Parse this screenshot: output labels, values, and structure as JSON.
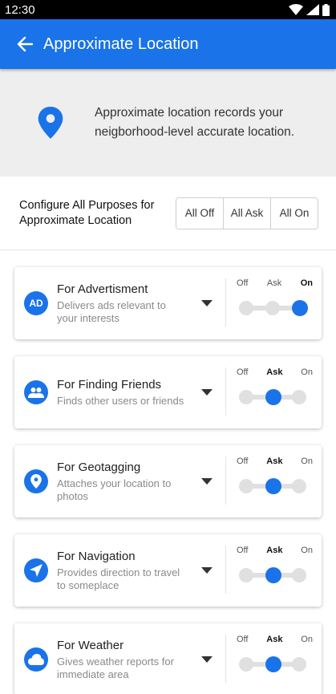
{
  "status_bar": {
    "time": "12:30"
  },
  "app_bar": {
    "title": "Approximate Location"
  },
  "info": {
    "text": "Approximate location records your neigborhood-level accurate location."
  },
  "configure": {
    "label": "Configure All Purposes for Approximate Location",
    "buttons": [
      "All Off",
      "All Ask",
      "All On"
    ]
  },
  "toggle_labels": [
    "Off",
    "Ask",
    "On"
  ],
  "purposes": [
    {
      "title": "For Advertisment",
      "desc": "Delivers ads relevant to your interests",
      "icon": "ad-icon",
      "icon_text": "AD",
      "selected": "On"
    },
    {
      "title": "For Finding Friends",
      "desc": "Finds other users or friends",
      "icon": "people-icon",
      "selected": "Ask"
    },
    {
      "title": "For Geotagging",
      "desc": "Attaches your location to photos",
      "icon": "location-pin-icon",
      "selected": "Ask"
    },
    {
      "title": "For Navigation",
      "desc": "Provides direction to travel to someplace",
      "icon": "navigation-arrow-icon",
      "selected": "Ask"
    },
    {
      "title": "For Weather",
      "desc": "Gives weather reports for immediate area",
      "icon": "cloud-icon",
      "selected": "Ask"
    }
  ],
  "colors": {
    "primary": "#1a73e8",
    "info_bg": "#eeeeee"
  }
}
